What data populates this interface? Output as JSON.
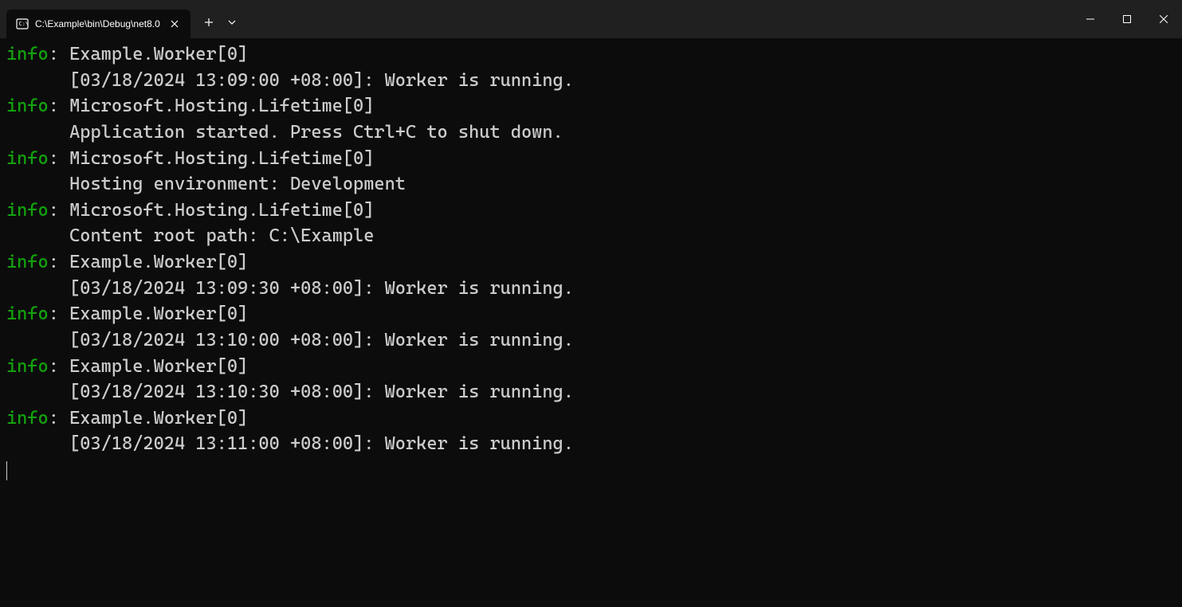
{
  "titlebar": {
    "tab_title": "C:\\Example\\bin\\Debug\\net8.0",
    "new_tab_label": "+",
    "dropdown_label": "⌄"
  },
  "log_entries": [
    {
      "level": "info",
      "source": "Example.Worker[0]",
      "message": "      [03/18/2024 13:09:00 +08:00]: Worker is running."
    },
    {
      "level": "info",
      "source": "Microsoft.Hosting.Lifetime[0]",
      "message": "      Application started. Press Ctrl+C to shut down."
    },
    {
      "level": "info",
      "source": "Microsoft.Hosting.Lifetime[0]",
      "message": "      Hosting environment: Development"
    },
    {
      "level": "info",
      "source": "Microsoft.Hosting.Lifetime[0]",
      "message": "      Content root path: C:\\Example"
    },
    {
      "level": "info",
      "source": "Example.Worker[0]",
      "message": "      [03/18/2024 13:09:30 +08:00]: Worker is running."
    },
    {
      "level": "info",
      "source": "Example.Worker[0]",
      "message": "      [03/18/2024 13:10:00 +08:00]: Worker is running."
    },
    {
      "level": "info",
      "source": "Example.Worker[0]",
      "message": "      [03/18/2024 13:10:30 +08:00]: Worker is running."
    },
    {
      "level": "info",
      "source": "Example.Worker[0]",
      "message": "      [03/18/2024 13:11:00 +08:00]: Worker is running."
    }
  ],
  "colors": {
    "info_level": "#13a10e",
    "text": "#cccccc",
    "background": "#0c0c0c",
    "titlebar": "#202020"
  }
}
